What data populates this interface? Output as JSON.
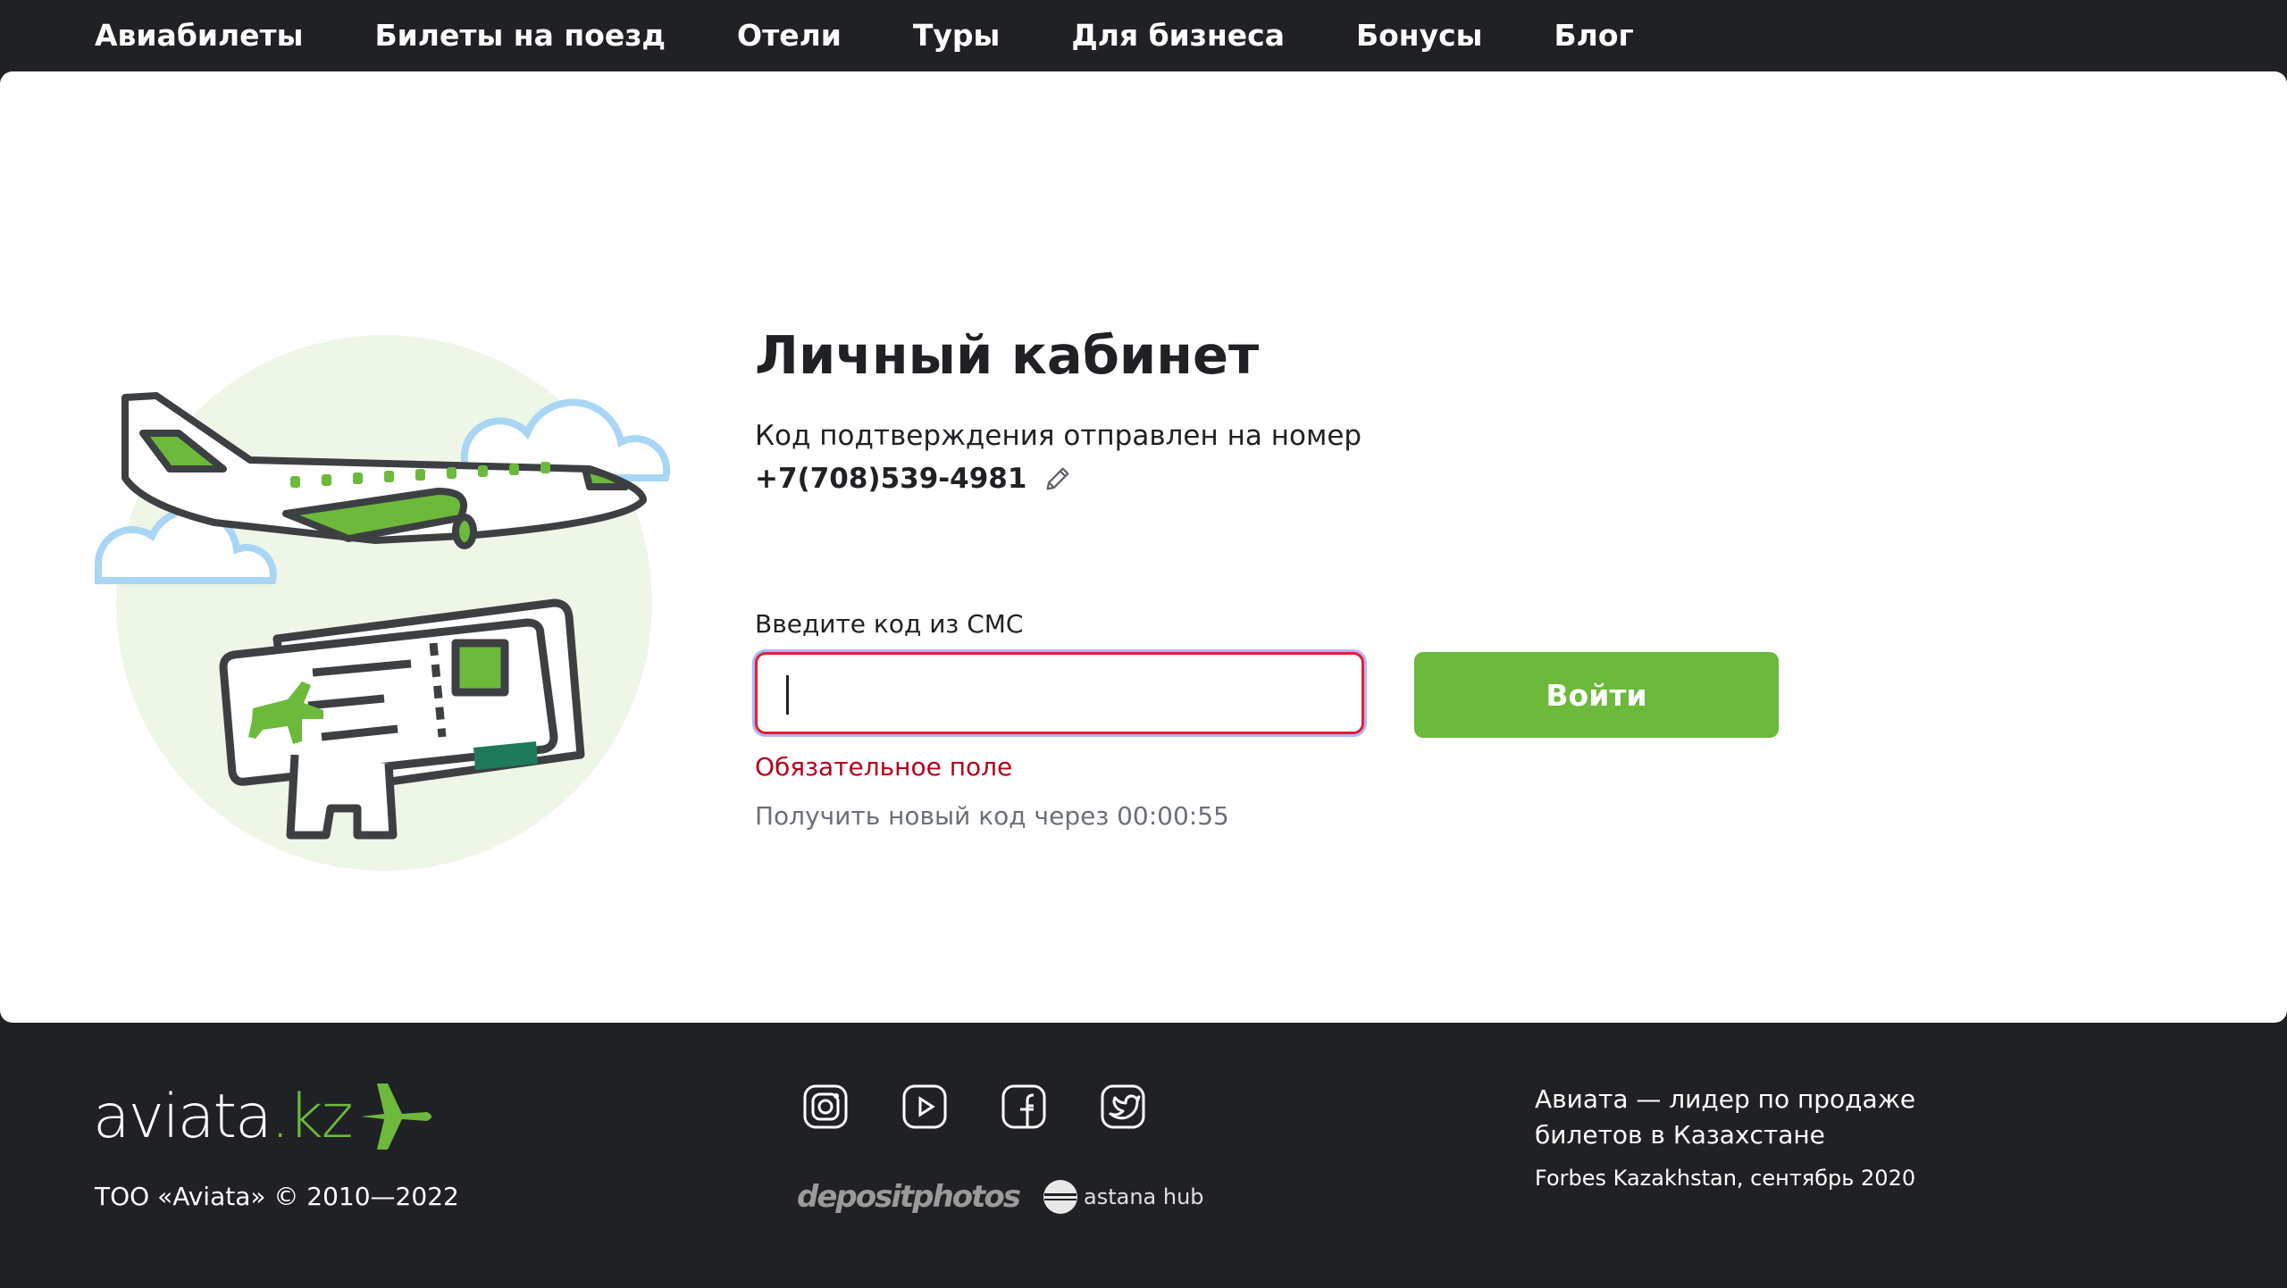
{
  "nav": {
    "items": [
      {
        "label": "Авиабилеты"
      },
      {
        "label": "Билеты на поезд"
      },
      {
        "label": "Отели"
      },
      {
        "label": "Туры"
      },
      {
        "label": "Для бизнеса"
      },
      {
        "label": "Бонусы"
      },
      {
        "label": "Блог"
      }
    ]
  },
  "login": {
    "title": "Личный кабинет",
    "sent_text": "Код подтверждения отправлен на номер",
    "phone": "+7(708)539-4981",
    "code_label": "Введите код из СМС",
    "code_value": "",
    "error": "Обязательное поле",
    "resend": "Получить новый код через 00:00:55",
    "submit_label": "Войти"
  },
  "footer": {
    "logo_main": "aviata",
    "logo_dot": ".",
    "logo_tld": "kz",
    "copyright": "ТОО «Aviata» © 2010—2022",
    "social": [
      "instagram-icon",
      "youtube-icon",
      "facebook-icon",
      "twitter-icon"
    ],
    "partners": {
      "depositphotos": "depositphotos",
      "astana_hub": "astana hub"
    },
    "tagline": "Авиата — лидер по продаже билетов в Казахстане",
    "source": "Forbes Kazakhstan, сентябрь 2020"
  },
  "colors": {
    "accent": "#6cb93b",
    "dark": "#202124",
    "error": "#b3001b",
    "cloud": "#a9d6f5"
  }
}
